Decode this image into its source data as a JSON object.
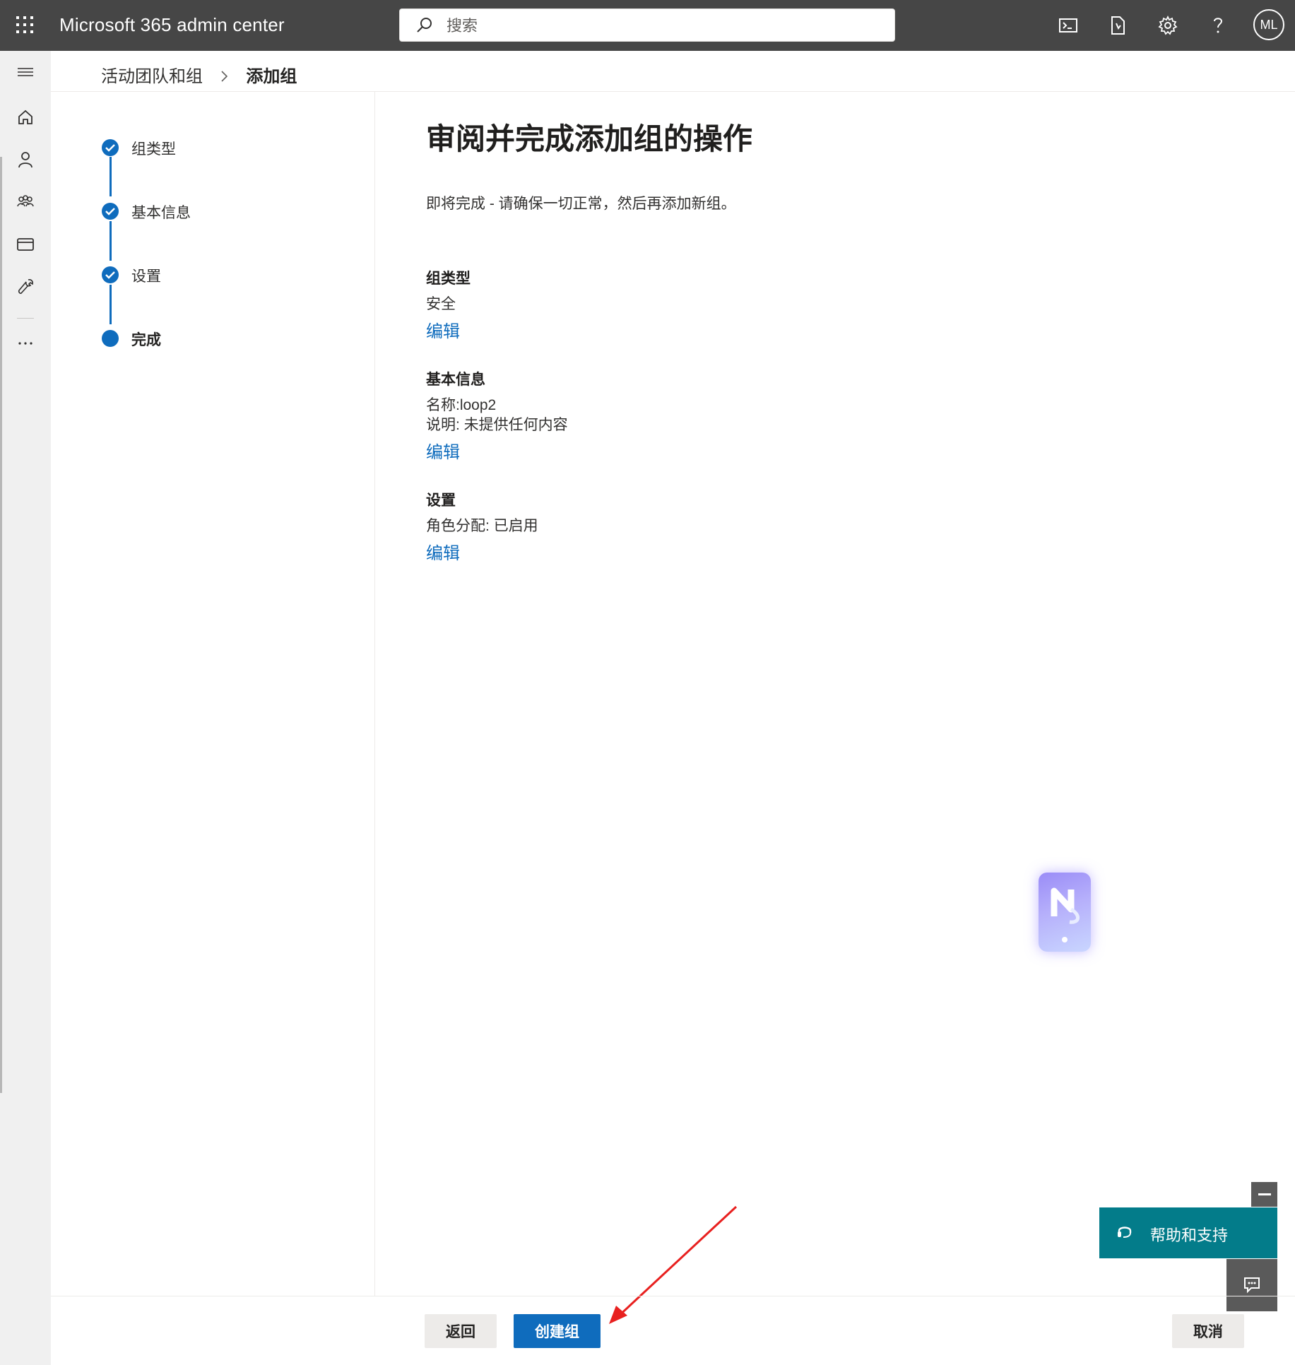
{
  "app": {
    "title": "Microsoft 365 admin center"
  },
  "search": {
    "placeholder": "搜索"
  },
  "header": {
    "avatar_initials": "ML"
  },
  "breadcrumb": {
    "parent": "活动团队和组",
    "current": "添加组"
  },
  "steps": [
    {
      "label": "组类型",
      "state": "completed"
    },
    {
      "label": "基本信息",
      "state": "completed"
    },
    {
      "label": "设置",
      "state": "completed"
    },
    {
      "label": "完成",
      "state": "current"
    }
  ],
  "main": {
    "title": "审阅并完成添加组的操作",
    "subtitle": "即将完成 - 请确保一切正常，然后再添加新组。",
    "sections": [
      {
        "title": "组类型",
        "lines": [
          "安全"
        ],
        "edit_label": "编辑"
      },
      {
        "title": "基本信息",
        "lines": [
          "名称:loop2",
          "说明: 未提供任何内容"
        ],
        "edit_label": "编辑"
      },
      {
        "title": "设置",
        "lines": [
          "角色分配: 已启用"
        ],
        "edit_label": "编辑"
      }
    ]
  },
  "footer": {
    "back_label": "返回",
    "create_label": "创建组",
    "cancel_label": "取消"
  },
  "help": {
    "label": "帮助和支持"
  },
  "colors": {
    "topbar": "#464646",
    "accent": "#0f6cbd",
    "help_teal": "#037c8a",
    "annotation_arrow": "#e8201f"
  },
  "icons": [
    "waffle-icon",
    "search-icon",
    "terminal-icon",
    "document-icon",
    "gear-icon",
    "help-icon",
    "menu-icon",
    "home-icon",
    "user-icon",
    "group-icon",
    "billing-icon",
    "wrench-icon",
    "more-icon",
    "chevron-right-icon",
    "checkmark-icon",
    "headset-icon",
    "chat-icon",
    "minimize-icon"
  ]
}
